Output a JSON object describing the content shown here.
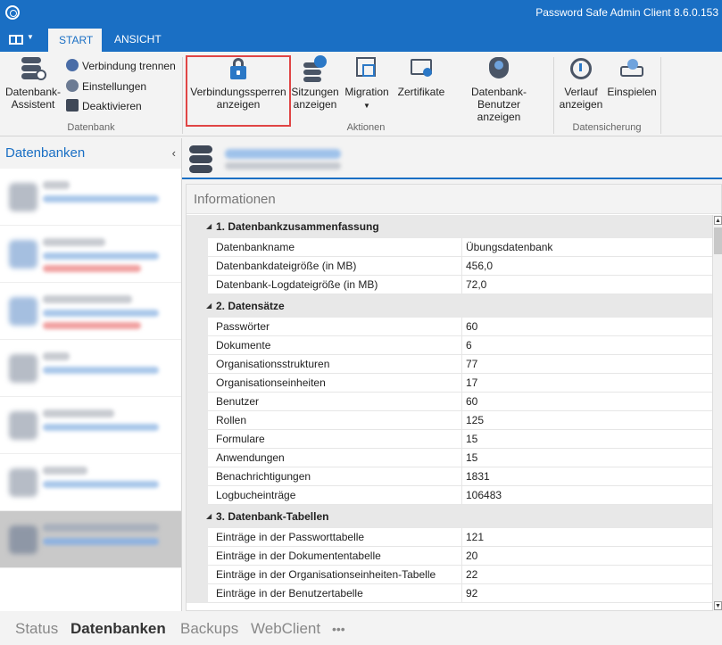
{
  "window": {
    "title": "Password Safe Admin Client 8.6.0.153"
  },
  "tabs": [
    {
      "label": "START",
      "active": true
    },
    {
      "label": "ANSICHT",
      "active": false
    }
  ],
  "ribbon": {
    "db_assistant_label": "Datenbank-\nAssistent",
    "disconnect_label": "Verbindung trennen",
    "settings_label": "Einstellungen",
    "deactivate_label": "Deaktivieren",
    "group_datenbank": "Datenbank",
    "locks_label": "Verbindungssperren\nanzeigen",
    "sessions_label": "Sitzungen\nanzeigen",
    "migration_label": "Migration",
    "certificates_label": "Zertifikate",
    "dbusers_label": "Datenbank-Benutzer\nanzeigen",
    "group_aktionen": "Aktionen",
    "history_label": "Verlauf\nanzeigen",
    "restore_label": "Einspielen",
    "group_datensicherung": "Datensicherung"
  },
  "left_panel": {
    "title": "Datenbanken",
    "item_count": 7,
    "selected_index": 6
  },
  "info": {
    "title": "Informationen",
    "sections": [
      {
        "title": "1. Datenbankzusammenfassung",
        "rows": [
          {
            "key": "Datenbankname",
            "value": "Übungsdatenbank"
          },
          {
            "key": "Datenbankdateigröße (in MB)",
            "value": "456,0"
          },
          {
            "key": "Datenbank-Logdateigröße (in MB)",
            "value": "72,0"
          }
        ]
      },
      {
        "title": "2. Datensätze",
        "rows": [
          {
            "key": "Passwörter",
            "value": "60"
          },
          {
            "key": "Dokumente",
            "value": "6"
          },
          {
            "key": "Organisationsstrukturen",
            "value": "77"
          },
          {
            "key": "Organisationseinheiten",
            "value": "17"
          },
          {
            "key": "Benutzer",
            "value": "60"
          },
          {
            "key": "Rollen",
            "value": "125"
          },
          {
            "key": "Formulare",
            "value": "15"
          },
          {
            "key": "Anwendungen",
            "value": "15"
          },
          {
            "key": "Benachrichtigungen",
            "value": "1831"
          },
          {
            "key": "Logbucheinträge",
            "value": "106483"
          }
        ]
      },
      {
        "title": "3. Datenbank-Tabellen",
        "rows": [
          {
            "key": "Einträge in der Passworttabelle",
            "value": "121"
          },
          {
            "key": "Einträge in der Dokumententabelle",
            "value": "20"
          },
          {
            "key": "Einträge in der Organisationseinheiten-Tabelle",
            "value": "22"
          },
          {
            "key": "Einträge in der Benutzertabelle",
            "value": "92"
          }
        ]
      }
    ]
  },
  "bottom_tabs": [
    {
      "label": "Status",
      "active": false
    },
    {
      "label": "Datenbanken",
      "active": true
    },
    {
      "label": "Backups",
      "active": false
    },
    {
      "label": "WebClient",
      "active": false
    },
    {
      "label": "•••",
      "active": false
    }
  ],
  "colors": {
    "accent": "#1a6fc4",
    "highlight": "#e04545"
  }
}
